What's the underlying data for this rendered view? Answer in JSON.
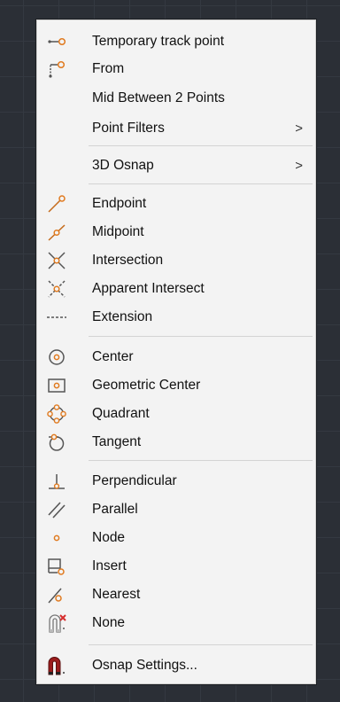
{
  "menu": {
    "items": {
      "temp_track": "Temporary track point",
      "from": "From",
      "mid_between": "Mid Between 2 Points",
      "point_filters": "Point Filters",
      "osnap3d": "3D Osnap",
      "endpoint": "Endpoint",
      "midpoint": "Midpoint",
      "intersection": "Intersection",
      "apparent": "Apparent Intersect",
      "extension": "Extension",
      "center": "Center",
      "geometric_center": "Geometric Center",
      "quadrant": "Quadrant",
      "tangent": "Tangent",
      "perpendicular": "Perpendicular",
      "parallel": "Parallel",
      "node": "Node",
      "insert": "Insert",
      "nearest": "Nearest",
      "none": "None",
      "osnap_settings": "Osnap Settings..."
    },
    "submenu_arrow": ">"
  },
  "colors": {
    "menu_bg": "#f3f3f3",
    "icon_line": "#555555",
    "icon_accent": "#e07a1f",
    "none_x": "#d62d2d",
    "magnet": "#9b1c1c"
  }
}
